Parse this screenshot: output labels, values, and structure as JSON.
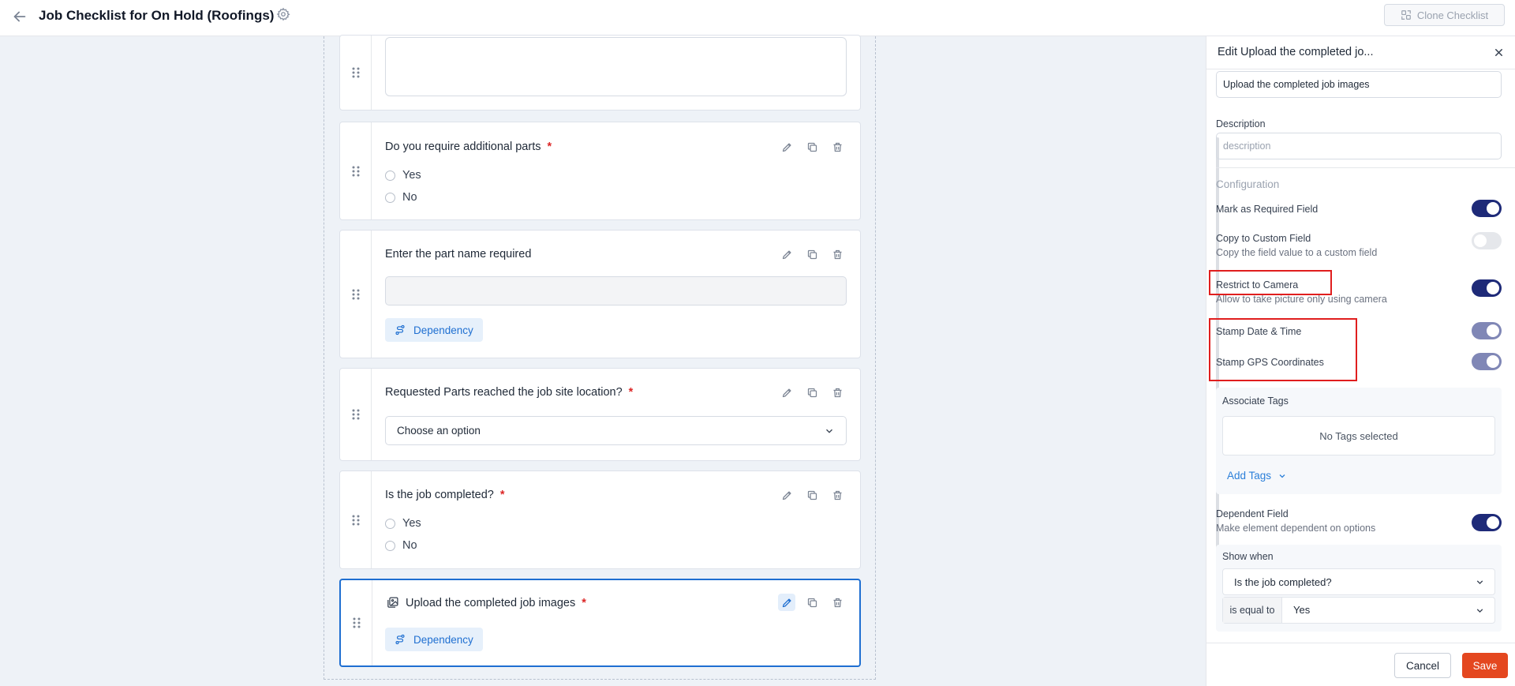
{
  "header": {
    "title": "Job Checklist for On Hold (Roofings)",
    "clone_label": "Clone Checklist"
  },
  "cards": [
    {
      "title": "Do you require additional parts",
      "required": "*",
      "options": [
        "Yes",
        "No"
      ]
    },
    {
      "title": "Enter the part name required",
      "dependency_label": "Dependency"
    },
    {
      "title": "Requested Parts reached the job site location?",
      "required": "*",
      "select_placeholder": "Choose an option"
    },
    {
      "title": "Is the job completed?",
      "required": "*",
      "options": [
        "Yes",
        "No"
      ]
    },
    {
      "title": "Upload the completed job images",
      "required": "*",
      "dependency_label": "Dependency"
    }
  ],
  "panel": {
    "title": "Edit Upload the completed jo...",
    "name_value": "Upload the completed job images",
    "description_label": "Description",
    "description_placeholder": "description",
    "configuration_label": "Configuration",
    "required_label": "Mark as Required Field",
    "copy_label": "Copy to Custom Field",
    "copy_sub": "Copy the field value to a custom field",
    "camera_label": "Restrict to Camera",
    "camera_sub": "Allow to take picture only using camera",
    "stamp_dt_label": "Stamp Date & Time",
    "stamp_gps_label": "Stamp GPS Coordinates",
    "tags_label": "Associate Tags",
    "no_tags": "No Tags selected",
    "add_tags": "Add Tags",
    "dependent_label": "Dependent Field",
    "dependent_sub": "Make element dependent on options",
    "show_when_label": "Show when",
    "show_when_value": "Is the job completed?",
    "is_equal_label": "is equal to",
    "is_equal_value": "Yes",
    "cancel_label": "Cancel",
    "save_label": "Save",
    "toggles": {
      "required": true,
      "copy": false,
      "camera": true,
      "stamp_dt": true,
      "stamp_gps": true,
      "dependent": true
    }
  },
  "colors": {
    "accent": "#1f6fd1",
    "toggle_on": "#1e2a78",
    "save": "#e4471f",
    "annotation": "#e01e1e"
  }
}
